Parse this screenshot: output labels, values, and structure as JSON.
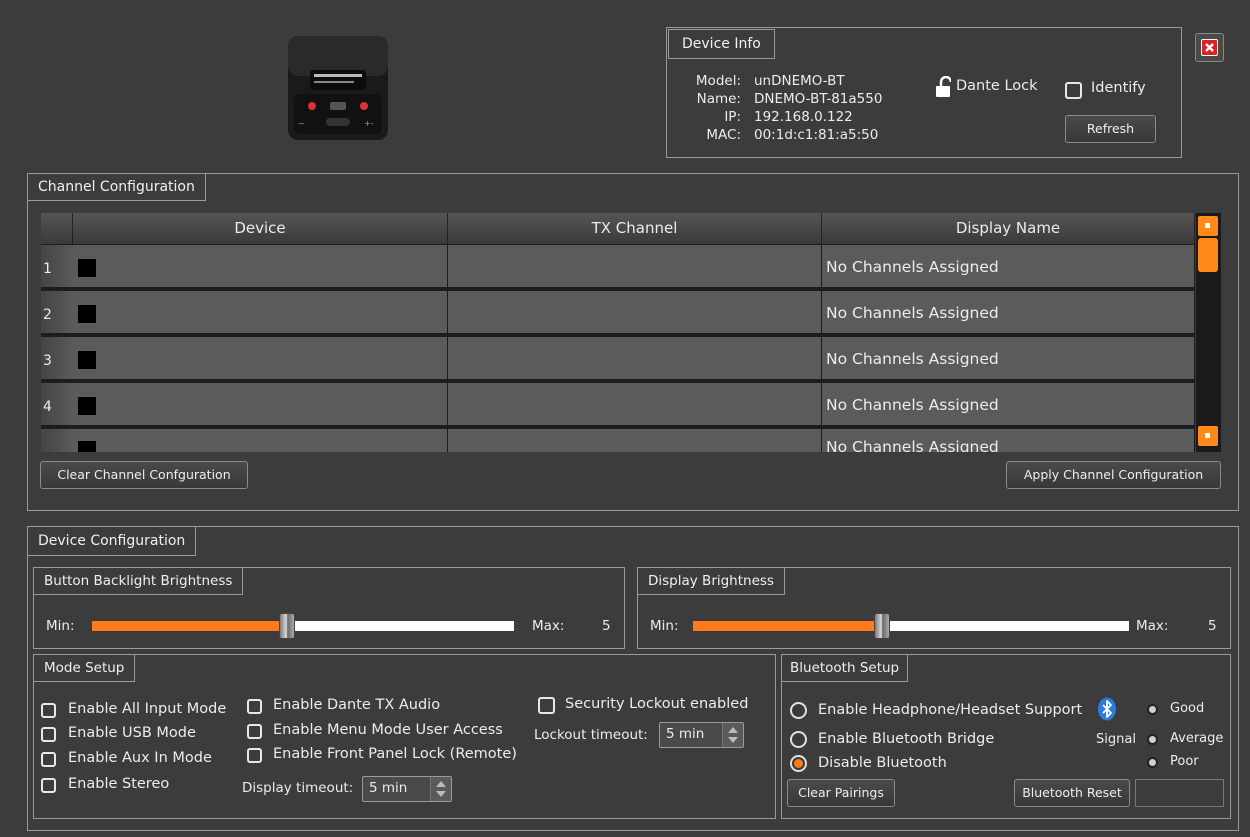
{
  "device_info": {
    "title": "Device Info",
    "model_label": "Model:",
    "model": "unDNEMO-BT",
    "name_label": "Name:",
    "name": "DNEMO-BT-81a550",
    "ip_label": "IP:",
    "ip": "192.168.0.122",
    "mac_label": "MAC:",
    "mac": "00:1d:c1:81:a5:50",
    "dante_lock": "Dante Lock",
    "identify": "Identify",
    "refresh": "Refresh"
  },
  "channel_config": {
    "title": "Channel Configuration",
    "columns": [
      "Device",
      "TX Channel",
      "Display Name"
    ],
    "rows": [
      {
        "num": "1",
        "device": "",
        "tx": "",
        "display": "No Channels Assigned"
      },
      {
        "num": "2",
        "device": "",
        "tx": "",
        "display": "No Channels Assigned"
      },
      {
        "num": "3",
        "device": "",
        "tx": "",
        "display": "No Channels Assigned"
      },
      {
        "num": "4",
        "device": "",
        "tx": "",
        "display": "No Channels Assigned"
      },
      {
        "num": "",
        "device": "",
        "tx": "",
        "display": "No Channels Assigned"
      }
    ],
    "clear_button": "Clear Channel Confguration",
    "apply_button": "Apply Channel Configuration"
  },
  "device_config": {
    "title": "Device Configuration",
    "button_backlight": {
      "title": "Button Backlight Brightness",
      "min": "Min:",
      "max": "Max:",
      "value": "5",
      "level": 0.45
    },
    "display_brightness": {
      "title": "Display Brightness",
      "min": "Min:",
      "max": "Max:",
      "value": "5",
      "level": 0.43
    }
  },
  "mode_setup": {
    "title": "Mode Setup",
    "col1": [
      "Enable All Input Mode",
      "Enable USB Mode",
      "Enable Aux In Mode",
      "Enable Stereo"
    ],
    "col2": [
      "Enable Dante TX Audio",
      "Enable Menu Mode User Access",
      "Enable Front Panel Lock (Remote)"
    ],
    "display_timeout_label": "Display timeout:",
    "display_timeout": "5 min",
    "security_lockout": "Security Lockout enabled",
    "lockout_timeout_label": "Lockout timeout:",
    "lockout_timeout": "5 min"
  },
  "bluetooth_setup": {
    "title": "Bluetooth Setup",
    "options": [
      "Enable Headphone/Headset Support",
      "Enable Bluetooth Bridge",
      "Disable Bluetooth"
    ],
    "selected": "Disable Bluetooth",
    "signal_label": "Signal",
    "signal_levels": [
      "Good",
      "Average",
      "Poor"
    ],
    "clear_pairings": "Clear Pairings",
    "reset": "Bluetooth Reset",
    "icon": "bluetooth-icon",
    "accent": "#ff7a1a"
  }
}
